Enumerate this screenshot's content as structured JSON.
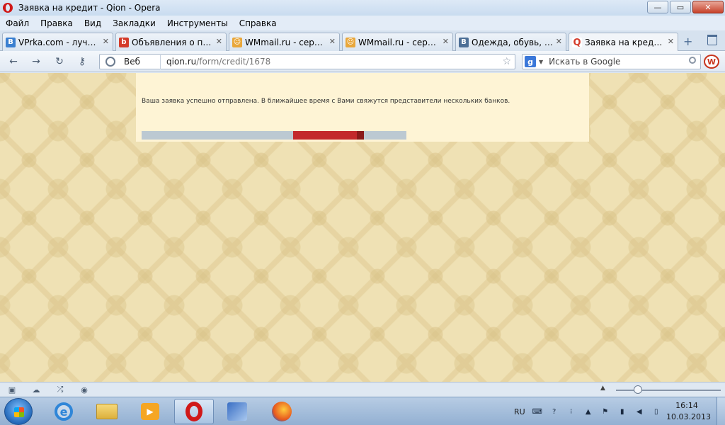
{
  "window": {
    "title": "Заявка на кредит - Qion - Opera",
    "controls": {
      "minimize": "—",
      "maximize": "▭",
      "close": "✕"
    }
  },
  "menu": [
    "Файл",
    "Правка",
    "Вид",
    "Закладки",
    "Инструменты",
    "Справка"
  ],
  "tabs": [
    {
      "label": "VPrka.com - лучша...",
      "icon": "vprka-favicon",
      "icon_glyph": "B",
      "icon_color": "#3a7fd0",
      "active": false
    },
    {
      "label": "Объявления о прод...",
      "icon": "bazar-favicon",
      "icon_glyph": "b",
      "icon_color": "#d43b2a",
      "active": false
    },
    {
      "label": "WMmail.ru - сервис...",
      "icon": "wmmail-favicon",
      "icon_glyph": "☺",
      "icon_color": "#e9a73a",
      "active": false
    },
    {
      "label": "WMmail.ru - сервис...",
      "icon": "wmmail-favicon",
      "icon_glyph": "☺",
      "icon_color": "#e9a73a",
      "active": false
    },
    {
      "label": "Одежда, обувь, акс...",
      "icon": "vk-favicon",
      "icon_glyph": "B",
      "icon_color": "#4d6f96",
      "active": false
    },
    {
      "label": "Заявка на кредит - ...",
      "icon": "qion-favicon",
      "icon_glyph": "Q",
      "icon_color": "#d43b2a",
      "active": true
    }
  ],
  "tab_close_glyph": "✕",
  "tab_add_glyph": "+",
  "nav": {
    "back": "←",
    "forward": "→",
    "reload": "↻",
    "key": "⚷"
  },
  "address": {
    "label": "Веб",
    "host": "qion.ru",
    "path": "/form/credit/1678",
    "star": "☆"
  },
  "search": {
    "engine_glyph": "g",
    "caret": "▼",
    "placeholder": "Искать в Google"
  },
  "wand_glyph": "W",
  "content": {
    "message": "Ваша заявка успешно отправлена. В ближайшее время с Вами свяжутся представители нескольких банков.",
    "progress": {
      "track_color": "#bcc9d2",
      "fill_color": "#c3292b"
    }
  },
  "statusbar": {
    "icons": [
      "panel-toggle-icon",
      "opera-unite-icon",
      "opera-turbo-icon",
      "speed-dial-icon"
    ],
    "glyphs": [
      "▣",
      "☁",
      "⤮",
      "◉"
    ],
    "zoom_caret": "▲"
  },
  "taskbar": {
    "apps": [
      {
        "name": "internet-explorer-app",
        "glyph": "e"
      },
      {
        "name": "explorer-app",
        "glyph": ""
      },
      {
        "name": "media-player-app",
        "glyph": "▶"
      },
      {
        "name": "opera-app",
        "glyph": ""
      },
      {
        "name": "tool-app",
        "glyph": ""
      },
      {
        "name": "firefox-app",
        "glyph": ""
      }
    ],
    "tray": {
      "lang": "RU",
      "icons": [
        "keyboard-icon",
        "help-icon",
        "tray-flag-icon",
        "tray-expand-icon",
        "action-center-icon",
        "network-icon",
        "volume-icon",
        "battery-icon"
      ],
      "glyphs": [
        "⌨",
        "?",
        "⁝",
        "▲",
        "⚑",
        "▮",
        "◀",
        "▯"
      ]
    },
    "time": "16:14",
    "date": "10.03.2013"
  }
}
